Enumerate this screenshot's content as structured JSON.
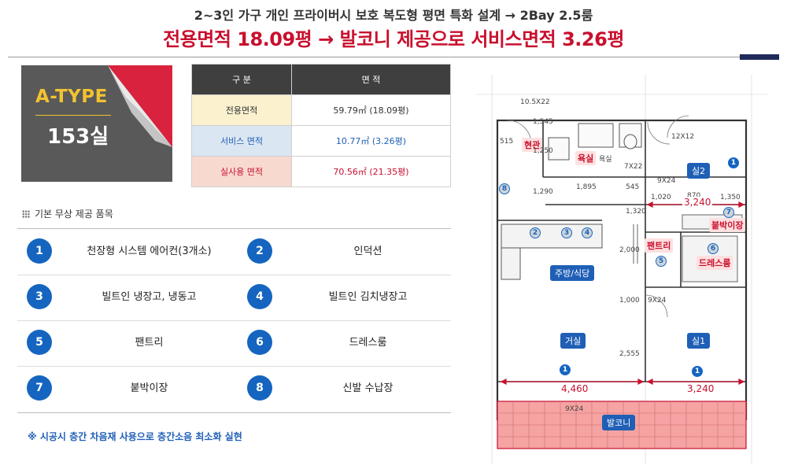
{
  "header": {
    "line1": "2~3인 가구 개인 프라이버시 보호 복도형 평면 특화 설계 → 2Bay 2.5룸",
    "line2": "전용면적 18.09평 → 발코니 제공으로 서비스면적 3.26평"
  },
  "type_card": {
    "name": "A-TYPE",
    "count": "153실"
  },
  "area_table": {
    "headers": [
      "구 분",
      "면 적"
    ],
    "rows": [
      {
        "label": "전용면적",
        "value": "59.79㎡ (18.09평)"
      },
      {
        "label": "서비스 면적",
        "value": "10.77㎡ (3.26평)"
      },
      {
        "label": "실사용 면적",
        "value": "70.56㎡ (21.35평)"
      }
    ]
  },
  "options": {
    "title": "기본 무상 제공 품목",
    "items": [
      {
        "num": "1",
        "label": "천장형 시스템 에어컨(3개소)"
      },
      {
        "num": "2",
        "label": "인덕션"
      },
      {
        "num": "3",
        "label": "빌트인 냉장고, 냉동고"
      },
      {
        "num": "4",
        "label": "빌트인 김치냉장고"
      },
      {
        "num": "5",
        "label": "팬트리"
      },
      {
        "num": "6",
        "label": "드레스룸"
      },
      {
        "num": "7",
        "label": "붙박이장"
      },
      {
        "num": "8",
        "label": "신발 수납장"
      }
    ],
    "note": "※ 시공시 층간 차음재 사용으로 층간소음 최소화 실현"
  },
  "floor_plan": {
    "rooms": {
      "entrance": "현관",
      "bathroom": "욕실",
      "kitchen": "주방/식당",
      "living": "거실",
      "room2": "실2",
      "room1": "실1",
      "pantry": "팬트리",
      "dressroom": "드레스룸",
      "closet": "붙박이장",
      "balcony": "발코니"
    },
    "dimensions": {
      "top_left": "1,895",
      "top_mid": "545",
      "top_right_a": "1,020",
      "top_right_b": "870",
      "top_right_c": "1,350",
      "corridor": "1,320",
      "v_a": "1,545",
      "v_b": "1,250",
      "v_c": "1,290",
      "v_d": "2,000",
      "v_e": "1,000",
      "v_f": "2,555",
      "left_small": "515",
      "room2_width": "3,240",
      "living_width": "4,460",
      "room1_width": "3,240"
    },
    "bubbles": {
      "room2_ac": "1",
      "living_ac": "1",
      "room1_ac": "1",
      "induction": "2",
      "fridge": "3",
      "kimchi": "4",
      "pantry": "5",
      "dress": "6",
      "closet": "7",
      "shoe": "8"
    },
    "fixture_labels": {
      "bath_tag": "욕실",
      "ac_tag_a": "10.5X22",
      "ac_tag_b": "12X12",
      "ac_tag_c": "9X24",
      "ac_tag_d": "9X24",
      "ac_tag_e": "9X24",
      "ac_tag_f": "7X22"
    }
  },
  "colors": {
    "accent_red": "#c8102e",
    "accent_blue": "#1565c0",
    "dark": "#3f3f3f",
    "card": "#595959",
    "gold": "#f2c230",
    "balcony_fill": "#f5a3a3"
  }
}
